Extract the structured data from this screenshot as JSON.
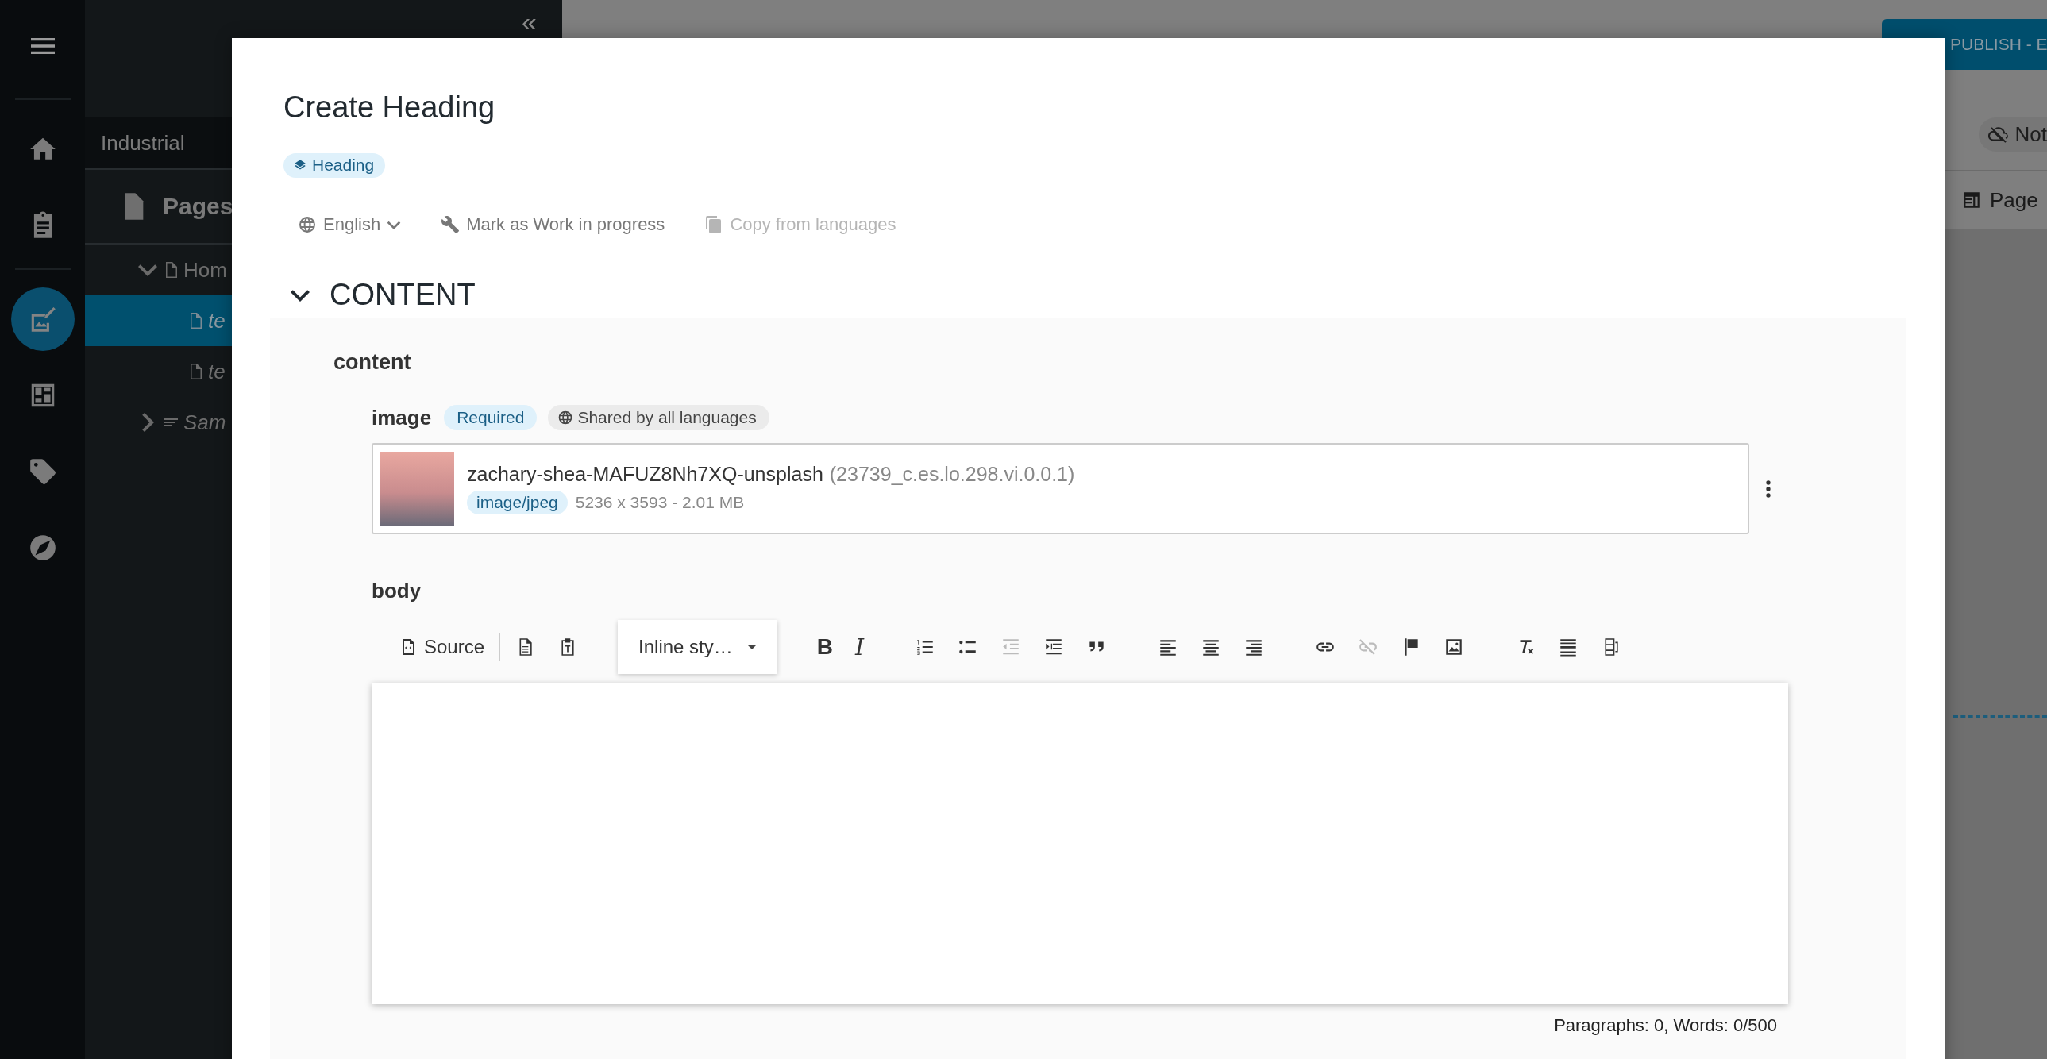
{
  "rail": {
    "items": [
      {
        "kind": "menu",
        "selected": false
      },
      {
        "kind": "home",
        "selected": false
      },
      {
        "kind": "clipboard",
        "selected": false
      },
      {
        "kind": "edit",
        "selected": true
      },
      {
        "kind": "dashboard",
        "selected": false
      },
      {
        "kind": "tag",
        "selected": false
      },
      {
        "kind": "compass",
        "selected": false
      }
    ]
  },
  "tree_panel": {
    "collapse": "«",
    "workspace": "Industrial",
    "title": "Pages",
    "nodes": [
      {
        "label": "Hom",
        "kind": "page",
        "expanded": true,
        "selected": false,
        "unpublished": false,
        "children": [
          {
            "label": "te",
            "kind": "page",
            "selected": true,
            "unpublished": true
          },
          {
            "label": "te",
            "kind": "page",
            "selected": false,
            "unpublished": true
          }
        ]
      },
      {
        "label": "Sam",
        "kind": "menu",
        "expanded": false,
        "selected": false,
        "unpublished": true
      }
    ]
  },
  "header": {
    "publish_button": "PUBLISH - E",
    "status_chip": "Not",
    "tab": "Page"
  },
  "dialog": {
    "title": "Create Heading",
    "type_chip": "Heading",
    "actions": [
      {
        "kind": "language",
        "label": "English",
        "disabled": false
      },
      {
        "kind": "wrench",
        "label": "Mark as Work in progress",
        "disabled": false
      },
      {
        "kind": "copy",
        "label": "Copy from languages",
        "disabled": true
      }
    ],
    "section": {
      "title": "CONTENT",
      "expanded": true
    },
    "group_label": "content",
    "image_field": {
      "label": "image",
      "required_chip": "Required",
      "shared_chip": "Shared by all languages",
      "file_name": "zachary-shea-MAFUZ8Nh7XQ-unsplash",
      "file_id": "(23739_c.es.lo.298.vi.0.0.1)",
      "mime_chip": "image/jpeg",
      "file_info": "5236 x 3593 - 2.01 MB"
    },
    "body_field": {
      "label": "body",
      "toolbar": [
        {
          "kind": "source",
          "label": "Source",
          "disabled": false
        },
        {
          "kind": "separator"
        },
        {
          "kind": "document",
          "disabled": false
        },
        {
          "kind": "paste-text",
          "disabled": false
        },
        {
          "kind": "gap"
        },
        {
          "kind": "dropdown",
          "label": "Inline sty…"
        },
        {
          "kind": "gap"
        },
        {
          "kind": "bold",
          "label": "B",
          "disabled": false
        },
        {
          "kind": "italic",
          "label": "I",
          "disabled": false
        },
        {
          "kind": "gap"
        },
        {
          "kind": "numbered-list",
          "disabled": false
        },
        {
          "kind": "bullet-list",
          "disabled": false
        },
        {
          "kind": "outdent",
          "disabled": true
        },
        {
          "kind": "indent",
          "disabled": false
        },
        {
          "kind": "quote",
          "disabled": false
        },
        {
          "kind": "gap"
        },
        {
          "kind": "align-left",
          "disabled": false
        },
        {
          "kind": "align-center",
          "disabled": false
        },
        {
          "kind": "align-right",
          "disabled": false
        },
        {
          "kind": "gap"
        },
        {
          "kind": "link",
          "disabled": false
        },
        {
          "kind": "unlink",
          "disabled": true
        },
        {
          "kind": "flag",
          "disabled": false
        },
        {
          "kind": "image",
          "disabled": false
        },
        {
          "kind": "gap"
        },
        {
          "kind": "clear-format",
          "disabled": false
        },
        {
          "kind": "horizontal-line",
          "disabled": false
        },
        {
          "kind": "blocks",
          "disabled": false
        }
      ],
      "status": "Paragraphs: 0, Words: 0/500"
    }
  }
}
